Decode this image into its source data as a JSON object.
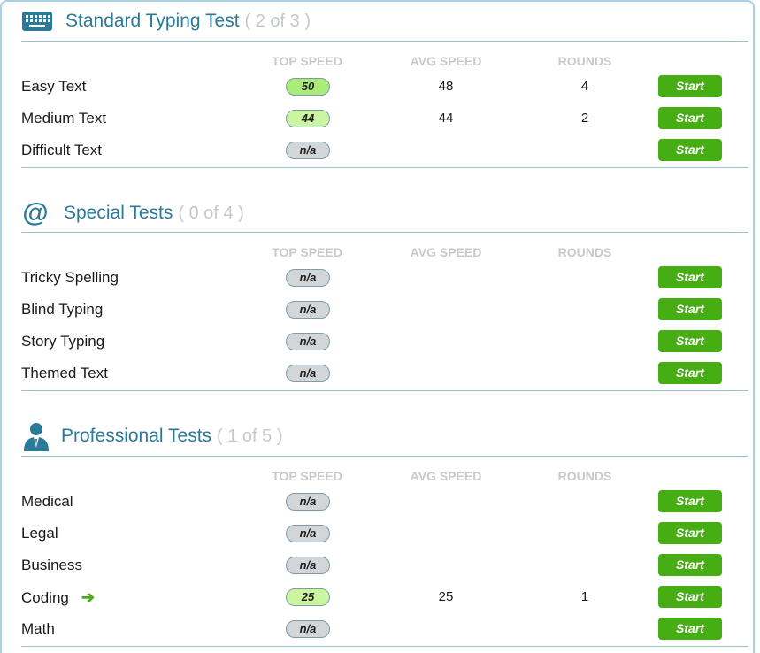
{
  "columns": {
    "top_speed": "TOP SPEED",
    "avg_speed": "AVG SPEED",
    "rounds": "ROUNDS"
  },
  "sections": [
    {
      "title": "Standard Typing Test",
      "count": "( 2 of 3 )",
      "icon": "keyboard-icon",
      "rows": [
        {
          "label": "Easy Text",
          "top": "50",
          "avg": "48",
          "rounds": "4",
          "start": "Start",
          "pill": "best"
        },
        {
          "label": "Medium Text",
          "top": "44",
          "avg": "44",
          "rounds": "2",
          "start": "Start",
          "pill": "good"
        },
        {
          "label": "Difficult Text",
          "top": "n/a",
          "avg": "",
          "rounds": "",
          "start": "Start",
          "pill": "none"
        }
      ]
    },
    {
      "title": "Special Tests",
      "count": "( 0 of 4 )",
      "icon": "at-sign-icon",
      "rows": [
        {
          "label": "Tricky Spelling",
          "top": "n/a",
          "avg": "",
          "rounds": "",
          "start": "Start",
          "pill": "none"
        },
        {
          "label": "Blind Typing",
          "top": "n/a",
          "avg": "",
          "rounds": "",
          "start": "Start",
          "pill": "none"
        },
        {
          "label": "Story Typing",
          "top": "n/a",
          "avg": "",
          "rounds": "",
          "start": "Start",
          "pill": "none"
        },
        {
          "label": "Themed Text",
          "top": "n/a",
          "avg": "",
          "rounds": "",
          "start": "Start",
          "pill": "none"
        }
      ]
    },
    {
      "title": "Professional Tests",
      "count": "( 1 of 5 )",
      "icon": "professional-person-icon",
      "rows": [
        {
          "label": "Medical",
          "top": "n/a",
          "avg": "",
          "rounds": "",
          "start": "Start",
          "pill": "none"
        },
        {
          "label": "Legal",
          "top": "n/a",
          "avg": "",
          "rounds": "",
          "start": "Start",
          "pill": "none"
        },
        {
          "label": "Business",
          "top": "n/a",
          "avg": "",
          "rounds": "",
          "start": "Start",
          "pill": "none"
        },
        {
          "label": "Coding",
          "top": "25",
          "avg": "25",
          "rounds": "1",
          "start": "Start",
          "pill": "good",
          "arrow": "➔"
        },
        {
          "label": "Math",
          "top": "n/a",
          "avg": "",
          "rounds": "",
          "start": "Start",
          "pill": "none"
        }
      ]
    }
  ],
  "colors": {
    "accent": "#2a7a9a",
    "start_button": "#46ae13",
    "pill_best": "#a9ec79",
    "pill_good": "#ccf5a2",
    "pill_none": "#d3d6d9"
  }
}
